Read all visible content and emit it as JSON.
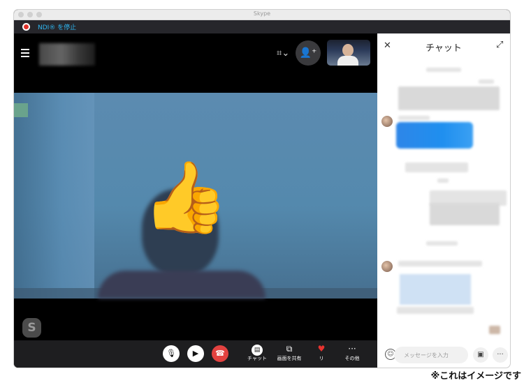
{
  "window": {
    "title": "Skype"
  },
  "ndi_bar": {
    "label": "NDI® を停止"
  },
  "call": {
    "layout_icon": "layout-icon",
    "add_participant_icon": "add-person-icon",
    "reaction": "👍"
  },
  "controls": {
    "mic_icon": "microphone-icon",
    "video_icon": "video-camera-icon",
    "end_icon": "end-call-icon",
    "chat_label": "チャット",
    "share_label": "画面を共有",
    "react_label": "リ",
    "more_label": "その他"
  },
  "chat": {
    "title": "チャット",
    "input_placeholder": "メッセージを入力"
  },
  "caption": "※これはイメージです",
  "colors": {
    "ndi_text": "#2fb7f2",
    "end_call": "#e34240",
    "heart": "#e8332f",
    "chat_bubble_blue": "#1f8fef"
  }
}
